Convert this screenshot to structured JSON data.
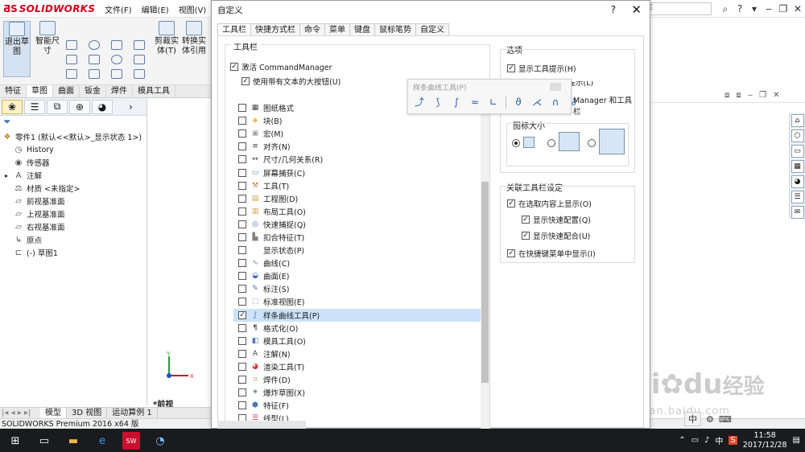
{
  "app": {
    "brand": "SOLIDWORKS",
    "menus": [
      "文件(F)",
      "编辑(E)",
      "视图(V)"
    ],
    "search_placeholder": "识库"
  },
  "ribbon": {
    "tools": [
      {
        "label": "退出草图"
      },
      {
        "label": "智能尺寸"
      },
      {
        "label": "剪裁实体(T)"
      },
      {
        "label": "转换实体引用"
      }
    ],
    "tabs": [
      "特征",
      "草图",
      "曲面",
      "钣金",
      "焊件",
      "模具工具"
    ],
    "active_tab": "草图"
  },
  "feature_tree": {
    "root": "零件1 (默认<<默认>_显示状态 1>)",
    "items": [
      {
        "label": "History",
        "icon": "history-icon"
      },
      {
        "label": "传感器",
        "icon": "sensor-icon"
      },
      {
        "label": "注解",
        "icon": "annotation-icon"
      },
      {
        "label": "材质 <未指定>",
        "icon": "material-icon"
      },
      {
        "label": "前视基准面",
        "icon": "plane-icon"
      },
      {
        "label": "上视基准面",
        "icon": "plane-icon"
      },
      {
        "label": "右视基准面",
        "icon": "plane-icon"
      },
      {
        "label": "原点",
        "icon": "origin-icon"
      },
      {
        "label": "(-) 草图1",
        "icon": "sketch-icon"
      }
    ]
  },
  "viewport": {
    "view_label": "*前视"
  },
  "bottom_tabs": [
    "模型",
    "3D 视图",
    "运动算例 1"
  ],
  "status_bar": "SOLIDWORKS Premium 2016 x64 版",
  "dialog": {
    "title": "自定义",
    "help": "?",
    "close": "✕",
    "tabs": [
      "工具栏",
      "快捷方式栏",
      "命令",
      "菜单",
      "键盘",
      "鼠标笔势",
      "自定义"
    ],
    "active_tab": "工具栏",
    "toolbar_group_title": "工具栏",
    "activate_cm": "激活 CommandManager",
    "large_buttons": "使用带有文本的大按钮(U)",
    "toolbars": [
      {
        "label": "图纸格式",
        "checked": false,
        "icon": "sheet-format-icon",
        "color": "#ffffff"
      },
      {
        "label": "块(B)",
        "checked": false,
        "icon": "block-icon",
        "color": "#f0c060"
      },
      {
        "label": "宏(M)",
        "checked": false,
        "icon": "macro-icon",
        "color": "#a0a0a0"
      },
      {
        "label": "对齐(N)",
        "checked": false,
        "icon": "align-icon",
        "color": "#ffffff"
      },
      {
        "label": "尺寸/几何关系(R)",
        "checked": false,
        "icon": "dimension-icon",
        "color": "#ffffff"
      },
      {
        "label": "屏幕捕获(C)",
        "checked": false,
        "icon": "screen-capture-icon",
        "color": "#6090c0"
      },
      {
        "label": "工具(T)",
        "checked": false,
        "icon": "tools-icon",
        "color": "#c08040"
      },
      {
        "label": "工程图(D)",
        "checked": false,
        "icon": "drawing-icon",
        "color": "#d0a040"
      },
      {
        "label": "布局工具(O)",
        "checked": false,
        "icon": "layout-icon",
        "color": "#d0a040"
      },
      {
        "label": "快速捕捉(Q)",
        "checked": false,
        "icon": "quick-snap-icon",
        "color": "#4a7ab0"
      },
      {
        "label": "扣合特征(T)",
        "checked": false,
        "icon": "fastening-icon",
        "color": "#808080"
      },
      {
        "label": "显示状态(P)",
        "checked": false,
        "icon": "none",
        "color": "#ffffff"
      },
      {
        "label": "曲线(C)",
        "checked": false,
        "icon": "curve-icon",
        "color": "#4a8ac8"
      },
      {
        "label": "曲面(E)",
        "checked": false,
        "icon": "surface-icon",
        "color": "#3a6ab0"
      },
      {
        "label": "标注(S)",
        "checked": false,
        "icon": "annotation-icon",
        "color": "#3a7ac0"
      },
      {
        "label": "标准视图(E)",
        "checked": false,
        "icon": "standard-views-icon",
        "color": "#5a8ac0"
      },
      {
        "label": "样条曲线工具(P)",
        "checked": true,
        "icon": "spline-icon",
        "color": "#2a6ab0"
      },
      {
        "label": "格式化(O)",
        "checked": false,
        "icon": "format-icon",
        "color": "#ffffff"
      },
      {
        "label": "模具工具(O)",
        "checked": false,
        "icon": "mold-icon",
        "color": "#4a7ab0"
      },
      {
        "label": "注解(N)",
        "checked": false,
        "icon": "note-icon",
        "color": "#ffffff"
      },
      {
        "label": "渲染工具(T)",
        "checked": false,
        "icon": "render-icon",
        "color": "#d04040"
      },
      {
        "label": "焊件(D)",
        "checked": false,
        "icon": "weldment-icon",
        "color": "#c08040"
      },
      {
        "label": "爆炸草图(X)",
        "checked": false,
        "icon": "explode-icon",
        "color": "#6a8ab0"
      },
      {
        "label": "特征(F)",
        "checked": false,
        "icon": "feature-icon",
        "color": "#4a7ab0"
      },
      {
        "label": "线型(L)",
        "checked": false,
        "icon": "line-format-icon",
        "color": "#c04040"
      },
      {
        "label": "草图(K)",
        "checked": false,
        "icon": "sketch-icon",
        "color": "#3a6ab0"
      }
    ],
    "floating_toolbar_title": "样条曲线工具(P)",
    "options_title": "选项",
    "show_tooltips": "显示工具提示(H)",
    "partial_tooltip": "使用大工具提示(L)",
    "partial_cm": "Manager 和工具栏",
    "icon_size_title": "图标大小",
    "icon_size_selected": "small",
    "ctx_title": "关联工具栏设定",
    "ctx_show_in_selection": "在选取内容上显示(O)",
    "ctx_show_quick_config": "显示快速配置(Q)",
    "ctx_show_quick_mate": "显示快速配合(U)",
    "ctx_show_in_shortcut": "在快捷键菜单中显示(I)"
  },
  "watermark": {
    "brand": "Bai",
    "brand2": "du",
    "suffix": "经验",
    "url": "jingyan.baidu.com"
  },
  "ime": {
    "label": "中"
  },
  "taskbar": {
    "time": "11:58",
    "date": "2017/12/28",
    "ime": "中"
  }
}
